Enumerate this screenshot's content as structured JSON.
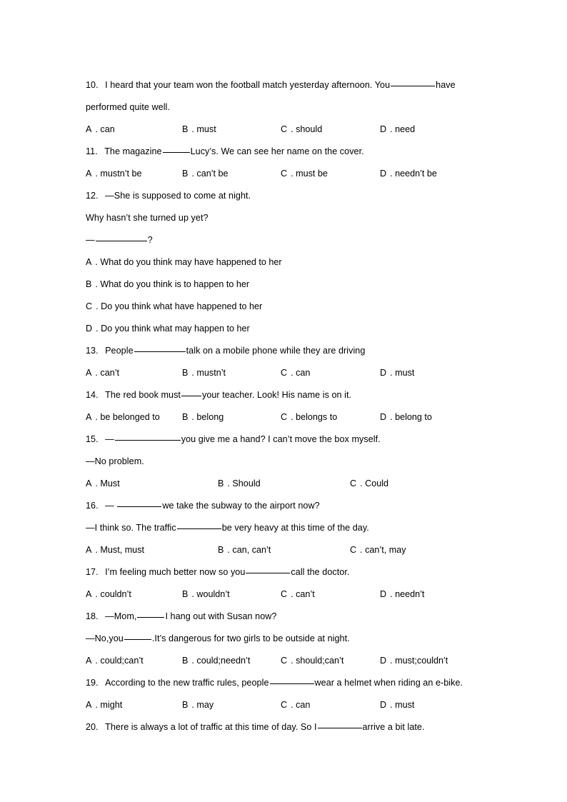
{
  "document": {
    "type": "english-grammar-worksheet",
    "topic": "modal verbs multiple choice",
    "background_color": "#ffffff",
    "text_color": "#000000"
  },
  "questions": [
    {
      "number": "10",
      "stem_part1": "I heard that your team won the football match yesterday afternoon. You",
      "stem_part2": "have",
      "stem_line2": "performed quite well.",
      "columns": 4,
      "options": [
        {
          "letter": "A",
          "text": "can"
        },
        {
          "letter": "B",
          "text": "must"
        },
        {
          "letter": "C",
          "text": "should"
        },
        {
          "letter": "D",
          "text": "need"
        }
      ]
    },
    {
      "number": "11",
      "stem_part1": "The magazine",
      "stem_part2": "Lucy’s. We can see her name on the cover.",
      "columns": 4,
      "options": [
        {
          "letter": "A",
          "text": "mustn’t be"
        },
        {
          "letter": "B",
          "text": "can’t be"
        },
        {
          "letter": "C",
          "text": "must be"
        },
        {
          "letter": "D",
          "text": "needn’t be"
        }
      ]
    },
    {
      "number": "12",
      "stem_part1": "—She is supposed  to come at night.",
      "stem_line2": "Why hasn’t she turned up yet?",
      "stem_line3_prefix": "—",
      "stem_line3_suffix": "?",
      "columns": 1,
      "options": [
        {
          "letter": "A",
          "text": "What do you think may have happened to her"
        },
        {
          "letter": "B",
          "text": "What do you think is to happen to her"
        },
        {
          "letter": "C",
          "text": "Do you think what have happened to her"
        },
        {
          "letter": "D",
          "text": "Do you think what may happen to her"
        }
      ]
    },
    {
      "number": "13",
      "stem_part1": "People",
      "stem_part2": "talk on a mobile phone while they are driving",
      "columns": 4,
      "options": [
        {
          "letter": "A",
          "text": "can’t"
        },
        {
          "letter": "B",
          "text": "mustn’t"
        },
        {
          "letter": "C",
          "text": "can"
        },
        {
          "letter": "D",
          "text": "must"
        }
      ]
    },
    {
      "number": "14",
      "stem_part1": "The red book must",
      "stem_part2": "your teacher. Look! His name is on it.",
      "columns": 4,
      "options": [
        {
          "letter": "A",
          "text": "be belonged to"
        },
        {
          "letter": "B",
          "text": "belong"
        },
        {
          "letter": "C",
          "text": "belongs to"
        },
        {
          "letter": "D",
          "text": "belong to"
        }
      ]
    },
    {
      "number": "15",
      "stem_part1": "—",
      "stem_part2": "you give me a hand? I can’t move the box myself.",
      "stem_line2": "—No problem.",
      "columns": 3,
      "options": [
        {
          "letter": "A",
          "text": "Must"
        },
        {
          "letter": "B",
          "text": "Should"
        },
        {
          "letter": "C",
          "text": "Could"
        }
      ]
    },
    {
      "number": "16",
      "stem_part1": "—",
      "stem_part2": "we take the subway to the airport now?",
      "stem_line2_part1": "—I think so. The traffic",
      "stem_line2_part2": "be very heavy at this time of the day.",
      "columns": 3,
      "options": [
        {
          "letter": "A",
          "text": "Must, must"
        },
        {
          "letter": "B",
          "text": "can, can’t"
        },
        {
          "letter": "C",
          "text": "can’t, may"
        }
      ]
    },
    {
      "number": "17",
      "stem_part1": "I’m feeling much better now so you",
      "stem_part2": "call the doctor.",
      "columns": 4,
      "options": [
        {
          "letter": "A",
          "text": "couldn’t"
        },
        {
          "letter": "B",
          "text": "wouldn’t"
        },
        {
          "letter": "C",
          "text": "can’t"
        },
        {
          "letter": "D",
          "text": "needn’t"
        }
      ]
    },
    {
      "number": "18",
      "stem_part1": "—Mom,",
      "stem_part2": "I hang out with Susan now?",
      "stem_line2_part1": "—No,you",
      "stem_line2_part2": ".It’s dangerous for two girls to be outside  at night.",
      "columns": 4,
      "options": [
        {
          "letter": "A",
          "text": "could;can’t"
        },
        {
          "letter": "B",
          "text": "could;needn’t"
        },
        {
          "letter": "C",
          "text": "should;can’t"
        },
        {
          "letter": "D",
          "text": "must;couldn’t"
        }
      ]
    },
    {
      "number": "19",
      "stem_part1": "According to the new traffic rules, people",
      "stem_part2": "wear a helmet when riding an e-bike.",
      "columns": 4,
      "options": [
        {
          "letter": "A",
          "text": "might"
        },
        {
          "letter": "B",
          "text": "may"
        },
        {
          "letter": "C",
          "text": "can"
        },
        {
          "letter": "D",
          "text": "must"
        }
      ]
    },
    {
      "number": "20",
      "stem_part1": "There is always a lot of traffic at this time of day. So I",
      "stem_part2": "arrive a bit late.",
      "columns": 0,
      "options": []
    }
  ]
}
